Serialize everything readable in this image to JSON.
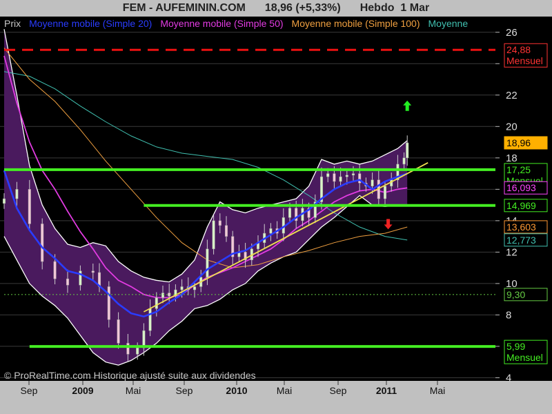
{
  "title": {
    "symbol": "FEM - AUFEMININ.COM",
    "quote": "18,96 (+5,33%)",
    "period": "Hebdo",
    "date": "1 Mar"
  },
  "legend": [
    {
      "text": "Prix",
      "color": "#c8c8c8"
    },
    {
      "text": "Moyenne mobile (Simple 20)",
      "color": "#2a3cff"
    },
    {
      "text": "Moyenne mobile (Simple 50)",
      "color": "#e23be2"
    },
    {
      "text": "Moyenne mobile (Simple 100)",
      "color": "#f0a040"
    },
    {
      "text": "Moyenne",
      "color": "#40c0b0"
    }
  ],
  "footer": "© ProRealTime.com Historique ajusté suite aux dividendes",
  "chart_data": {
    "type": "line",
    "ylim": [
      3.8,
      27
    ],
    "y_ticks": [
      4,
      6,
      8,
      10,
      12,
      14,
      16,
      18,
      20,
      22,
      24,
      26
    ],
    "x_ticks": [
      {
        "label": "Sep",
        "bold": false
      },
      {
        "label": "2009",
        "bold": true
      },
      {
        "label": "Mai",
        "bold": false
      },
      {
        "label": "Sep",
        "bold": false
      },
      {
        "label": "2010",
        "bold": true
      },
      {
        "label": "Mai",
        "bold": false
      },
      {
        "label": "Sep",
        "bold": false
      },
      {
        "label": "2011",
        "bold": true
      },
      {
        "label": "Mai",
        "bold": false
      }
    ],
    "price_series": [
      [
        0,
        15.4
      ],
      [
        4,
        16.0
      ],
      [
        8,
        13.8
      ],
      [
        12,
        11.4
      ],
      [
        16,
        10.3
      ],
      [
        20,
        9.9
      ],
      [
        24,
        10.8
      ],
      [
        28,
        10.7
      ],
      [
        30,
        9.8
      ],
      [
        33,
        7.7
      ],
      [
        36,
        6.2
      ],
      [
        39,
        5.5
      ],
      [
        42,
        5.9
      ],
      [
        44,
        7.0
      ],
      [
        46,
        8.4
      ],
      [
        48,
        9.1
      ],
      [
        50,
        9.4
      ],
      [
        52,
        9.2
      ],
      [
        54,
        9.6
      ],
      [
        56,
        9.8
      ],
      [
        58,
        9.6
      ],
      [
        60,
        9.8
      ],
      [
        62,
        10.4
      ],
      [
        64,
        12.2
      ],
      [
        66,
        14.0
      ],
      [
        68,
        13.7
      ],
      [
        70,
        13.0
      ],
      [
        72,
        11.7
      ],
      [
        74,
        12.0
      ],
      [
        76,
        11.5
      ],
      [
        78,
        12.2
      ],
      [
        80,
        12.6
      ],
      [
        82,
        13.2
      ],
      [
        84,
        13.5
      ],
      [
        86,
        13.2
      ],
      [
        88,
        14.2
      ],
      [
        90,
        14.8
      ],
      [
        92,
        14.0
      ],
      [
        94,
        14.8
      ],
      [
        96,
        14.2
      ],
      [
        98,
        15.2
      ],
      [
        100,
        16.8
      ],
      [
        102,
        17.0
      ],
      [
        104,
        16.5
      ],
      [
        106,
        16.8
      ],
      [
        108,
        16.9
      ],
      [
        110,
        17.0
      ],
      [
        112,
        16.4
      ],
      [
        114,
        16.2
      ],
      [
        116,
        16.6
      ],
      [
        118,
        15.4
      ],
      [
        120,
        16.2
      ],
      [
        122,
        16.6
      ],
      [
        124,
        17.6
      ],
      [
        126,
        18.0
      ],
      [
        127,
        18.96
      ]
    ],
    "sma20": [
      [
        0,
        17.2
      ],
      [
        4,
        14.8
      ],
      [
        8,
        13.4
      ],
      [
        12,
        12.3
      ],
      [
        16,
        11.6
      ],
      [
        20,
        10.8
      ],
      [
        24,
        10.6
      ],
      [
        28,
        10.2
      ],
      [
        32,
        9.5
      ],
      [
        36,
        8.7
      ],
      [
        40,
        8.1
      ],
      [
        44,
        7.9
      ],
      [
        48,
        8.2
      ],
      [
        52,
        8.8
      ],
      [
        56,
        9.3
      ],
      [
        60,
        10.1
      ],
      [
        64,
        10.9
      ],
      [
        68,
        11.4
      ],
      [
        72,
        11.9
      ],
      [
        76,
        12.1
      ],
      [
        80,
        12.6
      ],
      [
        84,
        13.1
      ],
      [
        88,
        13.6
      ],
      [
        92,
        14.2
      ],
      [
        96,
        14.7
      ],
      [
        100,
        15.4
      ],
      [
        104,
        16.0
      ],
      [
        108,
        16.4
      ],
      [
        112,
        16.6
      ],
      [
        116,
        16.0
      ],
      [
        120,
        16.5
      ],
      [
        124,
        16.8
      ],
      [
        127,
        17.0
      ]
    ],
    "sma50": [
      [
        0,
        24.5
      ],
      [
        4,
        21.5
      ],
      [
        8,
        19.0
      ],
      [
        12,
        17.2
      ],
      [
        16,
        16.0
      ],
      [
        20,
        14.6
      ],
      [
        24,
        13.3
      ],
      [
        28,
        12.2
      ],
      [
        32,
        11.0
      ],
      [
        36,
        10.2
      ],
      [
        40,
        9.8
      ],
      [
        44,
        9.3
      ],
      [
        48,
        9.1
      ],
      [
        52,
        9.1
      ],
      [
        56,
        9.3
      ],
      [
        60,
        9.9
      ],
      [
        64,
        10.4
      ],
      [
        68,
        10.7
      ],
      [
        72,
        11.0
      ],
      [
        76,
        11.4
      ],
      [
        80,
        11.8
      ],
      [
        84,
        12.2
      ],
      [
        88,
        12.8
      ],
      [
        92,
        13.5
      ],
      [
        96,
        14.0
      ],
      [
        100,
        14.6
      ],
      [
        104,
        15.2
      ],
      [
        108,
        15.6
      ],
      [
        112,
        15.9
      ],
      [
        116,
        16.0
      ],
      [
        120,
        15.8
      ],
      [
        124,
        16.0
      ],
      [
        127,
        16.09
      ]
    ],
    "sma100": [
      [
        0,
        25.0
      ],
      [
        8,
        23.0
      ],
      [
        16,
        21.6
      ],
      [
        24,
        19.8
      ],
      [
        32,
        17.8
      ],
      [
        40,
        16.0
      ],
      [
        48,
        14.2
      ],
      [
        56,
        12.6
      ],
      [
        64,
        11.5
      ],
      [
        72,
        11.0
      ],
      [
        80,
        11.2
      ],
      [
        88,
        11.7
      ],
      [
        96,
        12.1
      ],
      [
        104,
        12.6
      ],
      [
        112,
        13.0
      ],
      [
        120,
        13.2
      ],
      [
        127,
        13.6
      ]
    ],
    "sma200": [
      [
        0,
        23.5
      ],
      [
        8,
        23.2
      ],
      [
        16,
        22.4
      ],
      [
        24,
        21.3
      ],
      [
        32,
        20.3
      ],
      [
        40,
        19.4
      ],
      [
        48,
        18.7
      ],
      [
        56,
        18.3
      ],
      [
        64,
        18.1
      ],
      [
        72,
        17.9
      ],
      [
        80,
        17.4
      ],
      [
        88,
        16.6
      ],
      [
        96,
        15.6
      ],
      [
        104,
        14.5
      ],
      [
        112,
        13.6
      ],
      [
        120,
        13.0
      ],
      [
        127,
        12.77
      ]
    ],
    "boll_upper": [
      [
        0,
        26.2
      ],
      [
        4,
        22.0
      ],
      [
        8,
        17.5
      ],
      [
        12,
        15.0
      ],
      [
        16,
        13.5
      ],
      [
        20,
        12.5
      ],
      [
        24,
        12.3
      ],
      [
        28,
        12.6
      ],
      [
        32,
        12.4
      ],
      [
        36,
        11.4
      ],
      [
        40,
        10.8
      ],
      [
        44,
        10.4
      ],
      [
        48,
        10.2
      ],
      [
        52,
        10.1
      ],
      [
        56,
        10.6
      ],
      [
        60,
        11.5
      ],
      [
        64,
        13.6
      ],
      [
        68,
        15.2
      ],
      [
        72,
        14.7
      ],
      [
        76,
        14.5
      ],
      [
        80,
        14.8
      ],
      [
        84,
        15.0
      ],
      [
        88,
        15.2
      ],
      [
        92,
        15.4
      ],
      [
        96,
        16.2
      ],
      [
        100,
        17.9
      ],
      [
        104,
        17.6
      ],
      [
        108,
        17.8
      ],
      [
        112,
        17.6
      ],
      [
        116,
        17.8
      ],
      [
        120,
        18.2
      ],
      [
        124,
        18.6
      ],
      [
        127,
        19.1
      ]
    ],
    "boll_lower": [
      [
        0,
        13.0
      ],
      [
        4,
        11.5
      ],
      [
        8,
        10.0
      ],
      [
        12,
        9.2
      ],
      [
        16,
        8.6
      ],
      [
        20,
        7.8
      ],
      [
        24,
        6.7
      ],
      [
        28,
        5.6
      ],
      [
        32,
        5.0
      ],
      [
        36,
        4.8
      ],
      [
        40,
        5.1
      ],
      [
        44,
        5.6
      ],
      [
        48,
        6.2
      ],
      [
        52,
        7.0
      ],
      [
        56,
        7.6
      ],
      [
        60,
        8.4
      ],
      [
        64,
        8.6
      ],
      [
        68,
        9.0
      ],
      [
        72,
        9.6
      ],
      [
        76,
        10.0
      ],
      [
        80,
        10.8
      ],
      [
        84,
        11.3
      ],
      [
        88,
        11.7
      ],
      [
        92,
        12.0
      ],
      [
        96,
        12.8
      ],
      [
        100,
        13.6
      ],
      [
        104,
        14.2
      ],
      [
        108,
        14.9
      ],
      [
        112,
        15.6
      ],
      [
        116,
        15.0
      ],
      [
        120,
        14.9
      ],
      [
        124,
        15.0
      ],
      [
        127,
        14.97
      ]
    ],
    "trend_line": [
      [
        44,
        8.2
      ],
      [
        127,
        17.0
      ]
    ],
    "horizontal_lines": [
      {
        "value": 24.88,
        "color": "#ee1111",
        "style": "dashed",
        "x_from": 0
      },
      {
        "value": 17.25,
        "color": "#44ee22",
        "style": "solid",
        "x_from": 0
      },
      {
        "value": 14.97,
        "color": "#44ee22",
        "style": "solid",
        "x_from": 44
      },
      {
        "value": 5.99,
        "color": "#44ee22",
        "style": "solid",
        "x_from": 8
      },
      {
        "value": 9.3,
        "color": "#66cc44",
        "style": "dotted",
        "x_from": 0
      }
    ],
    "arrows": [
      {
        "direction": "up",
        "x": 127,
        "value": 21.3,
        "color": "#22ee22"
      },
      {
        "direction": "down",
        "x": 121,
        "value": 13.8,
        "color": "#ee2222"
      }
    ],
    "right_labels": [
      {
        "value": 24.88,
        "lines": [
          "24,88",
          "Mensuel"
        ],
        "bg": "#000000",
        "fg": "#ff3333",
        "border": "#ff3333"
      },
      {
        "value": 18.96,
        "lines": [
          "18,96"
        ],
        "bg": "#ffb000",
        "fg": "#000000",
        "border": "#ffb000"
      },
      {
        "value": 17.25,
        "lines": [
          "17,25",
          "Mensuel"
        ],
        "bg": "#000000",
        "fg": "#44ee22",
        "border": "#44ee22"
      },
      {
        "value": 16.093,
        "lines": [
          "16,093"
        ],
        "bg": "#000000",
        "fg": "#ff44ff",
        "border": "#ff44ff"
      },
      {
        "value": 14.97,
        "lines": [
          "14,969"
        ],
        "bg": "#000000",
        "fg": "#44ee22",
        "border": "#44ee22"
      },
      {
        "value": 13.603,
        "lines": [
          "13,603"
        ],
        "bg": "#000000",
        "fg": "#ff9933",
        "border": "#ff9933"
      },
      {
        "value": 12.773,
        "lines": [
          "12,773"
        ],
        "bg": "#000000",
        "fg": "#40c0b0",
        "border": "#40c0b0"
      },
      {
        "value": 9.3,
        "lines": [
          "9,30"
        ],
        "bg": "#000000",
        "fg": "#66cc44",
        "border": "#66cc44"
      },
      {
        "value": 5.99,
        "lines": [
          "5,99",
          "Mensuel"
        ],
        "bg": "#000000",
        "fg": "#44ee22",
        "border": "#44ee22"
      }
    ]
  }
}
